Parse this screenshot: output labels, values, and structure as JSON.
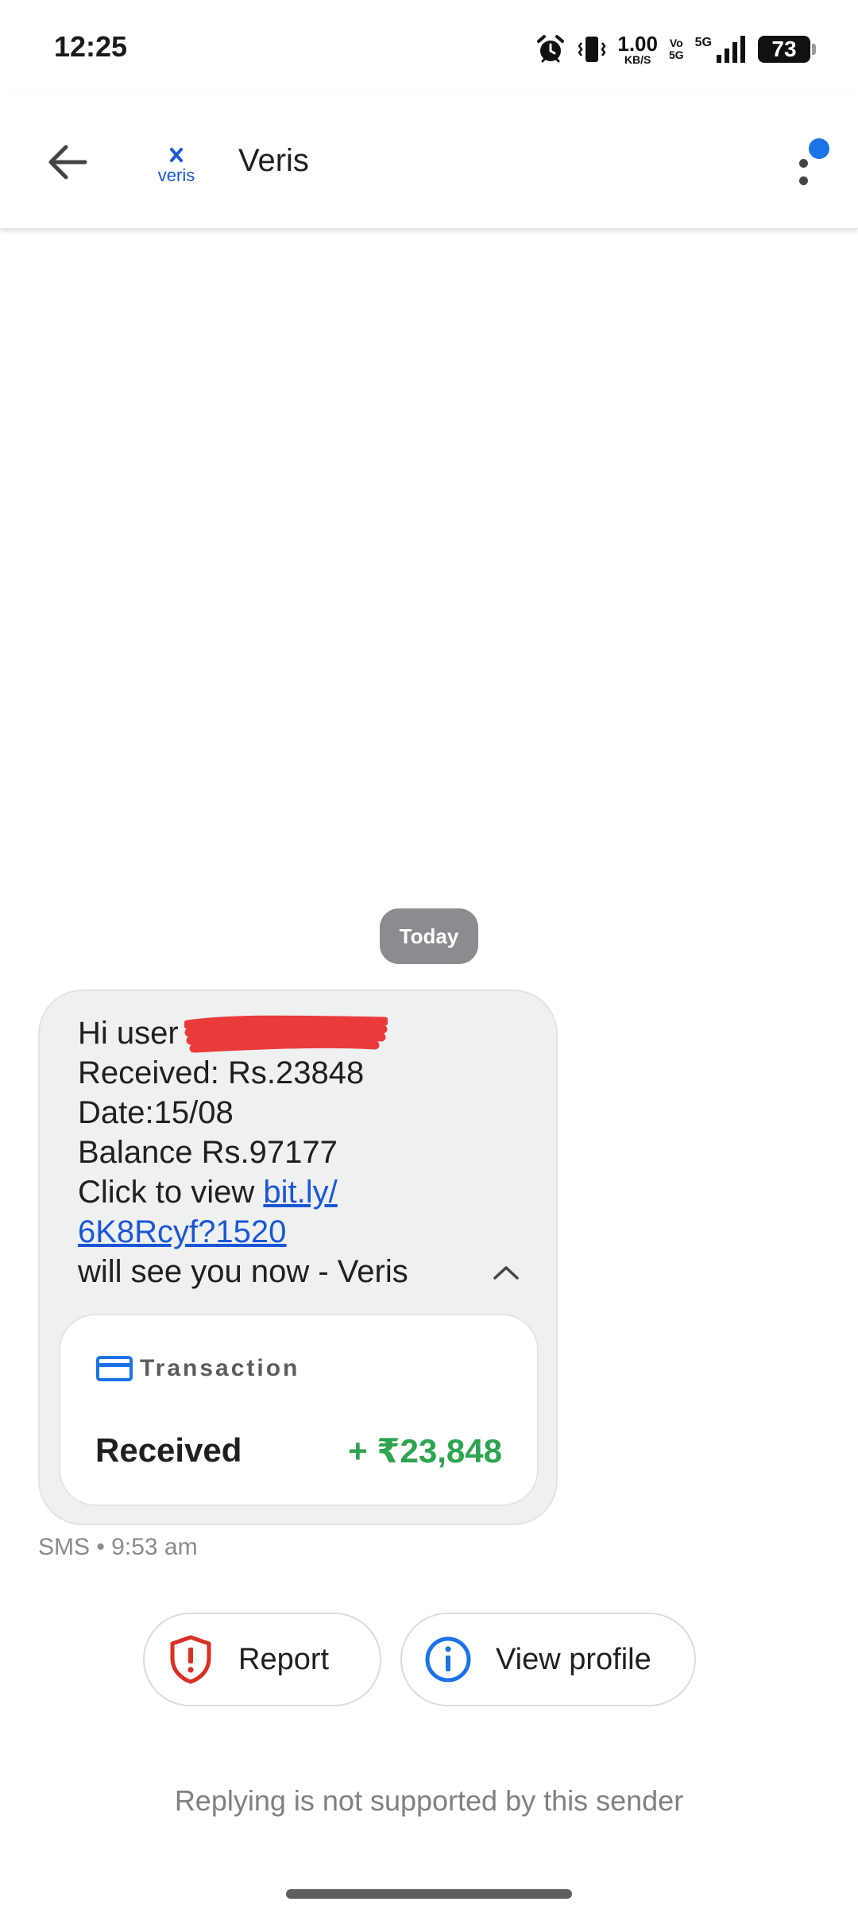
{
  "status_bar": {
    "time": "12:25",
    "net_speed_value": "1.00",
    "net_speed_unit": "KB/S",
    "volte_top": "Vo",
    "volte_bottom": "5G",
    "network_type": "5G",
    "battery_level": "73"
  },
  "app_bar": {
    "title": "Veris",
    "logo_text": "veris",
    "has_notification_badge": true,
    "accent_color": "#1a73e8"
  },
  "conversation": {
    "date_chip": "Today",
    "message": {
      "line1_prefix": "Hi user",
      "line2": "Received: Rs.23848",
      "line3": "Date:15/08",
      "line4": "Balance Rs.97177",
      "line5_prefix": "Click to view ",
      "link_part1": "bit.ly/",
      "link_part2": "6K8Rcyf?1520",
      "line7": "will see you now - Veris",
      "redaction_color": "#ea3b3b"
    },
    "transaction_card": {
      "label": "Transaction",
      "status": "Received",
      "amount": "+ ₹23,848",
      "amount_color": "#2ea44f"
    },
    "meta": "SMS • 9:53 am"
  },
  "actions": {
    "report_label": "Report",
    "view_profile_label": "View profile"
  },
  "footer": {
    "reply_note": "Replying is not supported by this sender"
  }
}
